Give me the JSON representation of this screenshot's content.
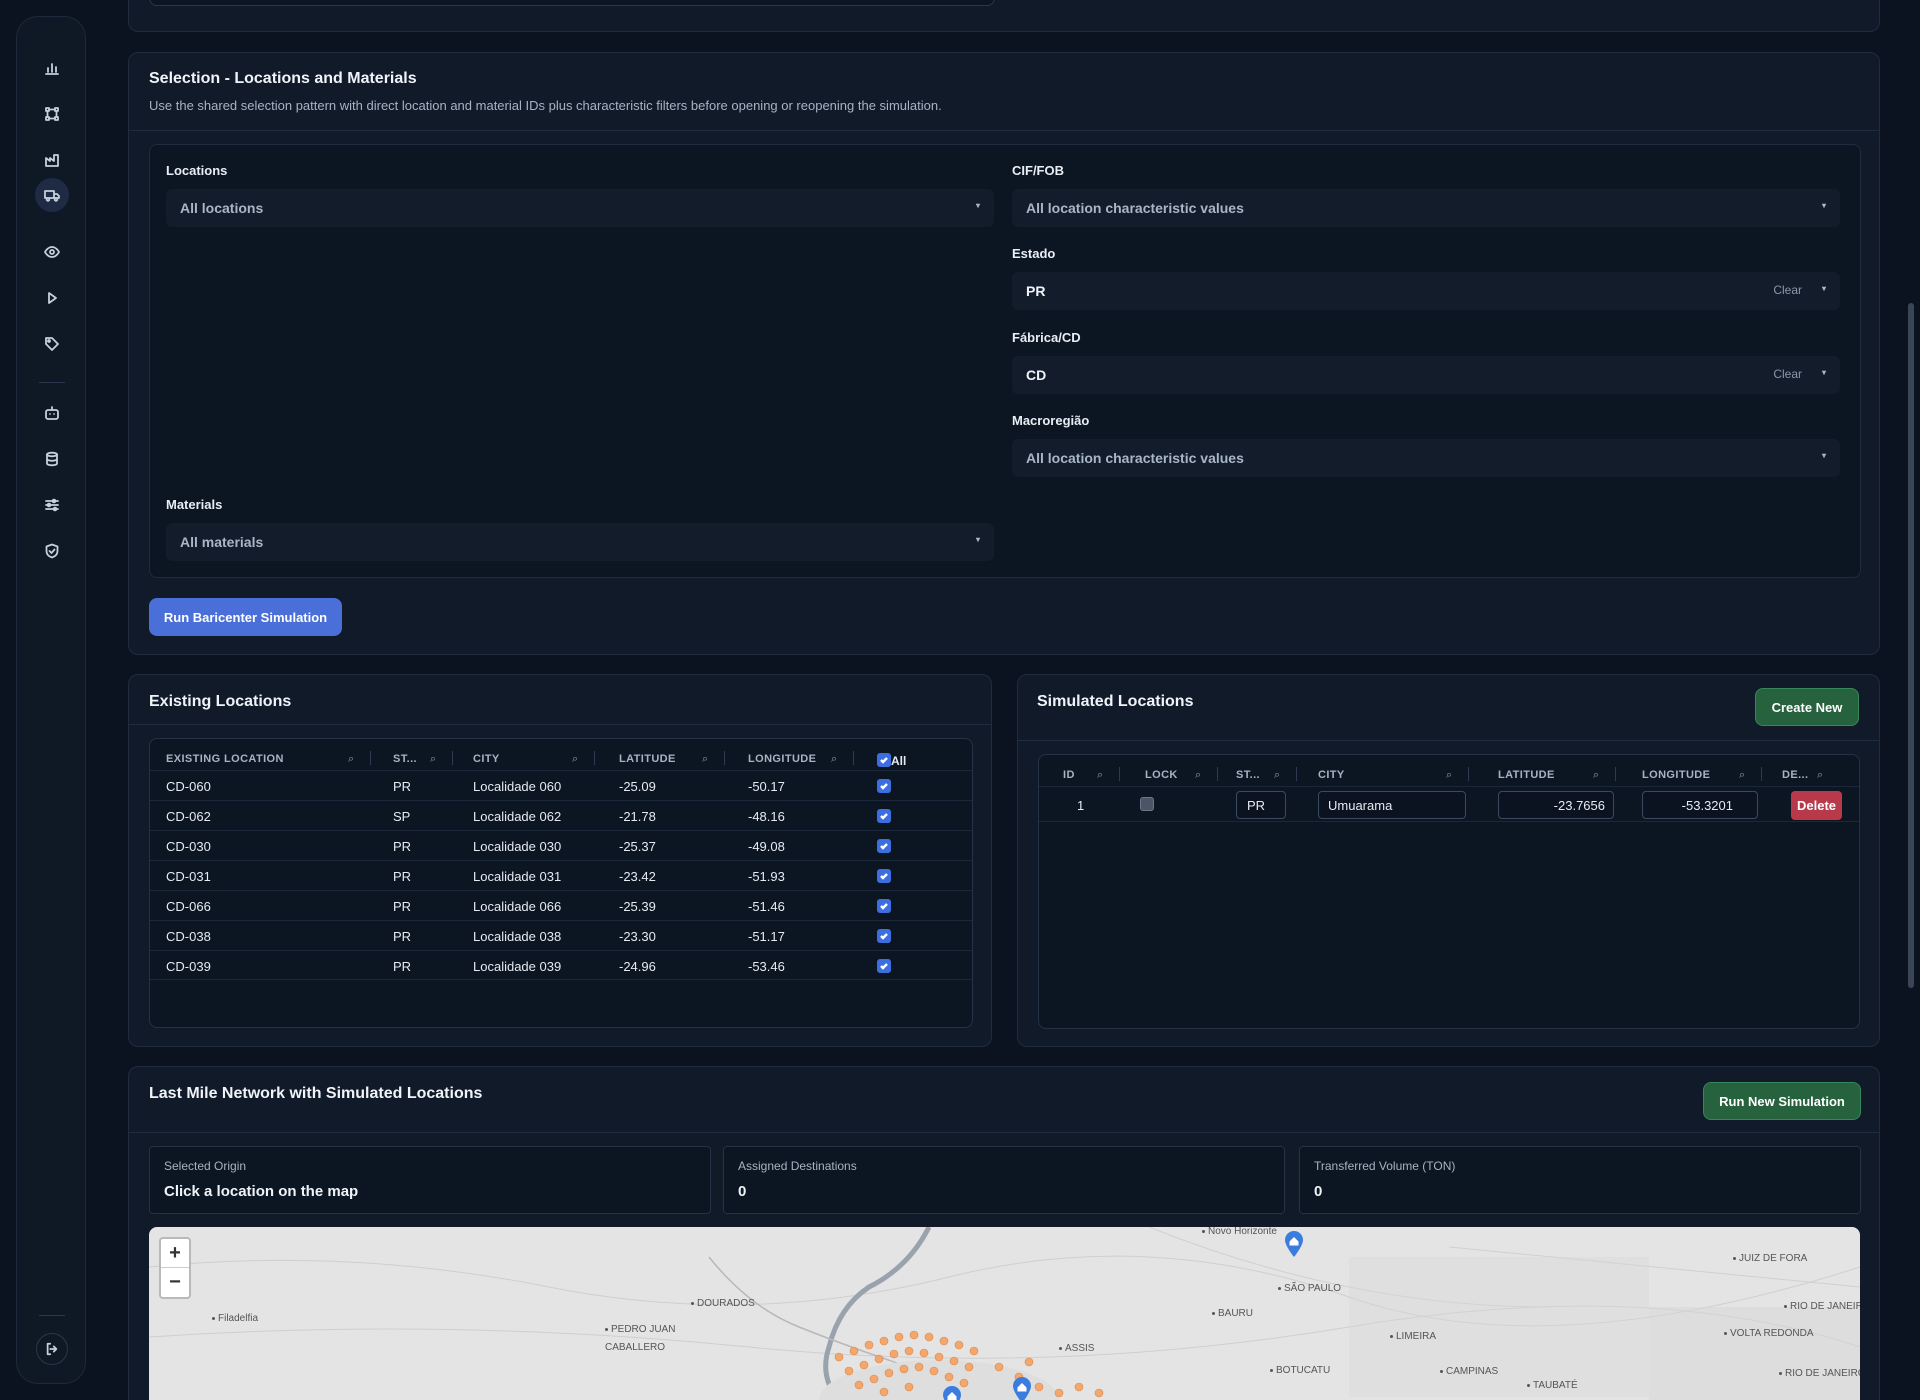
{
  "selection": {
    "title": "Selection - Locations and Materials",
    "description": "Use the shared selection pattern with direct location and material IDs plus characteristic filters before opening or reopening the simulation.",
    "locations_label": "Locations",
    "locations_value": "All locations",
    "materials_label": "Materials",
    "materials_value": "All materials",
    "filters": [
      {
        "label": "CIF/FOB",
        "value": "All location characteristic values",
        "clear": ""
      },
      {
        "label": "Estado",
        "value": "PR",
        "clear": "Clear"
      },
      {
        "label": "Fábrica/CD",
        "value": "CD",
        "clear": "Clear"
      },
      {
        "label": "Macroregião",
        "value": "All location characteristic values",
        "clear": ""
      }
    ],
    "run_button": "Run Baricenter Simulation"
  },
  "existing": {
    "title": "Existing Locations",
    "headers": [
      "EXISTING LOCATION",
      "ST...",
      "CITY",
      "LATITUDE",
      "LONGITUDE",
      "All"
    ],
    "rows": [
      {
        "id": "CD-060",
        "st": "PR",
        "city": "Localidade 060",
        "lat": "-25.09",
        "lon": "-50.17"
      },
      {
        "id": "CD-062",
        "st": "SP",
        "city": "Localidade 062",
        "lat": "-21.78",
        "lon": "-48.16"
      },
      {
        "id": "CD-030",
        "st": "PR",
        "city": "Localidade 030",
        "lat": "-25.37",
        "lon": "-49.08"
      },
      {
        "id": "CD-031",
        "st": "PR",
        "city": "Localidade 031",
        "lat": "-23.42",
        "lon": "-51.93"
      },
      {
        "id": "CD-066",
        "st": "PR",
        "city": "Localidade 066",
        "lat": "-25.39",
        "lon": "-51.46"
      },
      {
        "id": "CD-038",
        "st": "PR",
        "city": "Localidade 038",
        "lat": "-23.30",
        "lon": "-51.17"
      },
      {
        "id": "CD-039",
        "st": "PR",
        "city": "Localidade 039",
        "lat": "-24.96",
        "lon": "-53.46"
      }
    ]
  },
  "simulated": {
    "title": "Simulated Locations",
    "create_button": "Create New",
    "headers": [
      "ID",
      "LOCK",
      "ST...",
      "CITY",
      "LATITUDE",
      "LONGITUDE",
      "DE..."
    ],
    "rows": [
      {
        "id": "1",
        "st": "PR",
        "city": "Umuarama",
        "lat": "-23.7656",
        "lon": "-53.3201",
        "delete": "Delete"
      }
    ]
  },
  "network": {
    "title": "Last Mile Network with Simulated Locations",
    "run_button": "Run New Simulation",
    "stats": [
      {
        "label": "Selected Origin",
        "value": "Click a location on the map"
      },
      {
        "label": "Assigned Destinations",
        "value": "0"
      },
      {
        "label": "Transferred Volume (TON)",
        "value": "0"
      }
    ],
    "zoom_in": "+",
    "zoom_out": "−",
    "map_labels": [
      "Novo Horizonte",
      "JUIZ DE FORA",
      "SÃO PAULO",
      "RIO DE JANEIRO",
      "DOURADOS",
      "BAURU",
      "Filadelfia",
      "PEDRO JUAN CABALLERO",
      "ASSIS",
      "LIMEIRA",
      "VOLTA REDONDA",
      "BOTUCATU",
      "CAMPINAS",
      "TAUBATÉ",
      "RIO DE JANEIRO"
    ]
  },
  "colors": {
    "accent": "#4a6fd8",
    "success": "#27623f",
    "danger": "#b8394a",
    "background": "#0b1320"
  },
  "sidebar_icons": [
    "bar-chart-icon",
    "network-icon",
    "factory-icon",
    "truck-icon",
    "eye-icon",
    "play-icon",
    "tag-icon",
    "robot-icon",
    "database-icon",
    "sliders-icon",
    "shield-icon",
    "logout-icon"
  ]
}
